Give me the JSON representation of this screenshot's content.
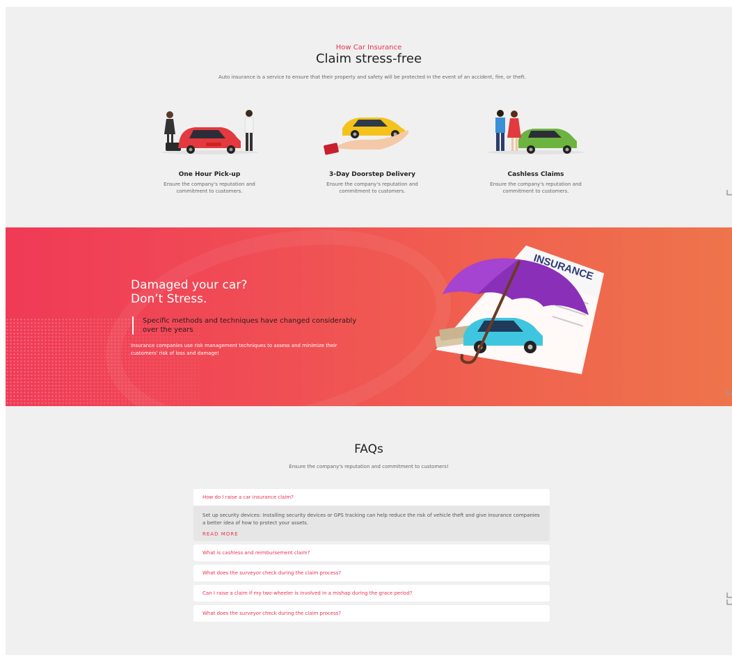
{
  "how": {
    "kicker": "How Car Insurance",
    "title": "Claim stress-free",
    "description": "Auto insurance is a service to ensure that their property and safety will be protected in the event of an accident, fire, or theft.",
    "features": [
      {
        "title": "One Hour Pick-up",
        "description": "Ensure the company's reputation and commitment to customers.",
        "icon": "car-pickup-illustration"
      },
      {
        "title": "3-Day Doorstep Delivery",
        "description": "Ensure the company's reputation and commitment to customers.",
        "icon": "car-in-hand-illustration"
      },
      {
        "title": "Cashless Claims",
        "description": "Ensure the company's reputation and commitment to customers.",
        "icon": "couple-with-car-illustration"
      }
    ]
  },
  "banner": {
    "title_line1": "Damaged your car?",
    "title_line2": "Don’t Stress.",
    "quote": "Specific methods and techniques have changed considerably over the years",
    "description": "Insurance companies use risk management techniques to assess and minimize their customers' risk of loss and damage!",
    "illustration_text": "INSURANCE"
  },
  "faq": {
    "title": "FAQs",
    "subtitle": "Ensure the company's reputation and commitment to customers!",
    "items": [
      {
        "question": "How do I raise a car insurance claim?"
      },
      {
        "question": "What is cashless and reimbursement claim?"
      },
      {
        "question": "What does the surveyor check during the claim process?"
      },
      {
        "question": "Can I raise a claim if my two-wheeler is involved in a mishap during the grace period?"
      },
      {
        "question": "What does the surveyor check during the claim process?"
      }
    ],
    "open_answer": "Set up security devices: Installing security devices or GPS tracking can help reduce the risk of vehicle theft and give insurance companies a better idea of how to protect your assets.",
    "read_more": "READ MORE"
  },
  "colors": {
    "accent": "#e8304f",
    "banner_start": "#f03a56",
    "banner_end": "#ee744b",
    "background": "#f0f0f0"
  }
}
